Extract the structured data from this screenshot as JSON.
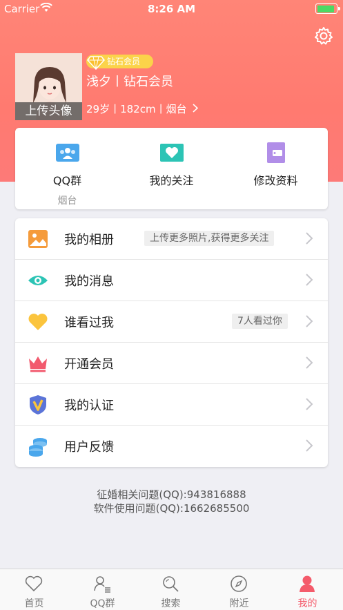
{
  "status_bar": {
    "carrier": "Carrier",
    "time": "8:26 AM"
  },
  "profile": {
    "vip_badge": "钻石会员",
    "nickname": "浅夕丨钻石会员",
    "info": "29岁丨182cm丨烟台",
    "upload_avatar": "上传头像",
    "settings_icon": "gear-icon"
  },
  "quick_actions": [
    {
      "label": "QQ群",
      "sub": "烟台",
      "icon": "group-icon"
    },
    {
      "label": "我的关注",
      "sub": "",
      "icon": "heart-icon"
    },
    {
      "label": "修改资料",
      "sub": "",
      "icon": "wallet-icon"
    }
  ],
  "menu": [
    {
      "label": "我的相册",
      "tag": "上传更多照片,获得更多关注",
      "icon": "photo-icon"
    },
    {
      "label": "我的消息",
      "tag": "",
      "icon": "eye-icon"
    },
    {
      "label": "谁看过我",
      "tag": "7人看过你",
      "icon": "heart-icon"
    },
    {
      "label": "开通会员",
      "tag": "",
      "icon": "crown-icon"
    },
    {
      "label": "我的认证",
      "tag": "",
      "icon": "verify-shield-icon"
    },
    {
      "label": "用户反馈",
      "tag": "",
      "icon": "coins-icon"
    }
  ],
  "contact": {
    "line1": "征婚相关问题(QQ):943816888",
    "line2": "软件使用问题(QQ):1662685500"
  },
  "tabs": [
    {
      "label": "首页",
      "icon": "heart-outline-icon",
      "active": false
    },
    {
      "label": "QQ群",
      "icon": "group-list-icon",
      "active": false
    },
    {
      "label": "搜索",
      "icon": "search-icon",
      "active": false
    },
    {
      "label": "附近",
      "icon": "compass-icon",
      "active": false
    },
    {
      "label": "我的",
      "icon": "user-icon",
      "active": true
    }
  ],
  "colors": {
    "header": "#ff7f74",
    "accent": "#f45b6b",
    "vip_gold": "#fbd34a"
  }
}
